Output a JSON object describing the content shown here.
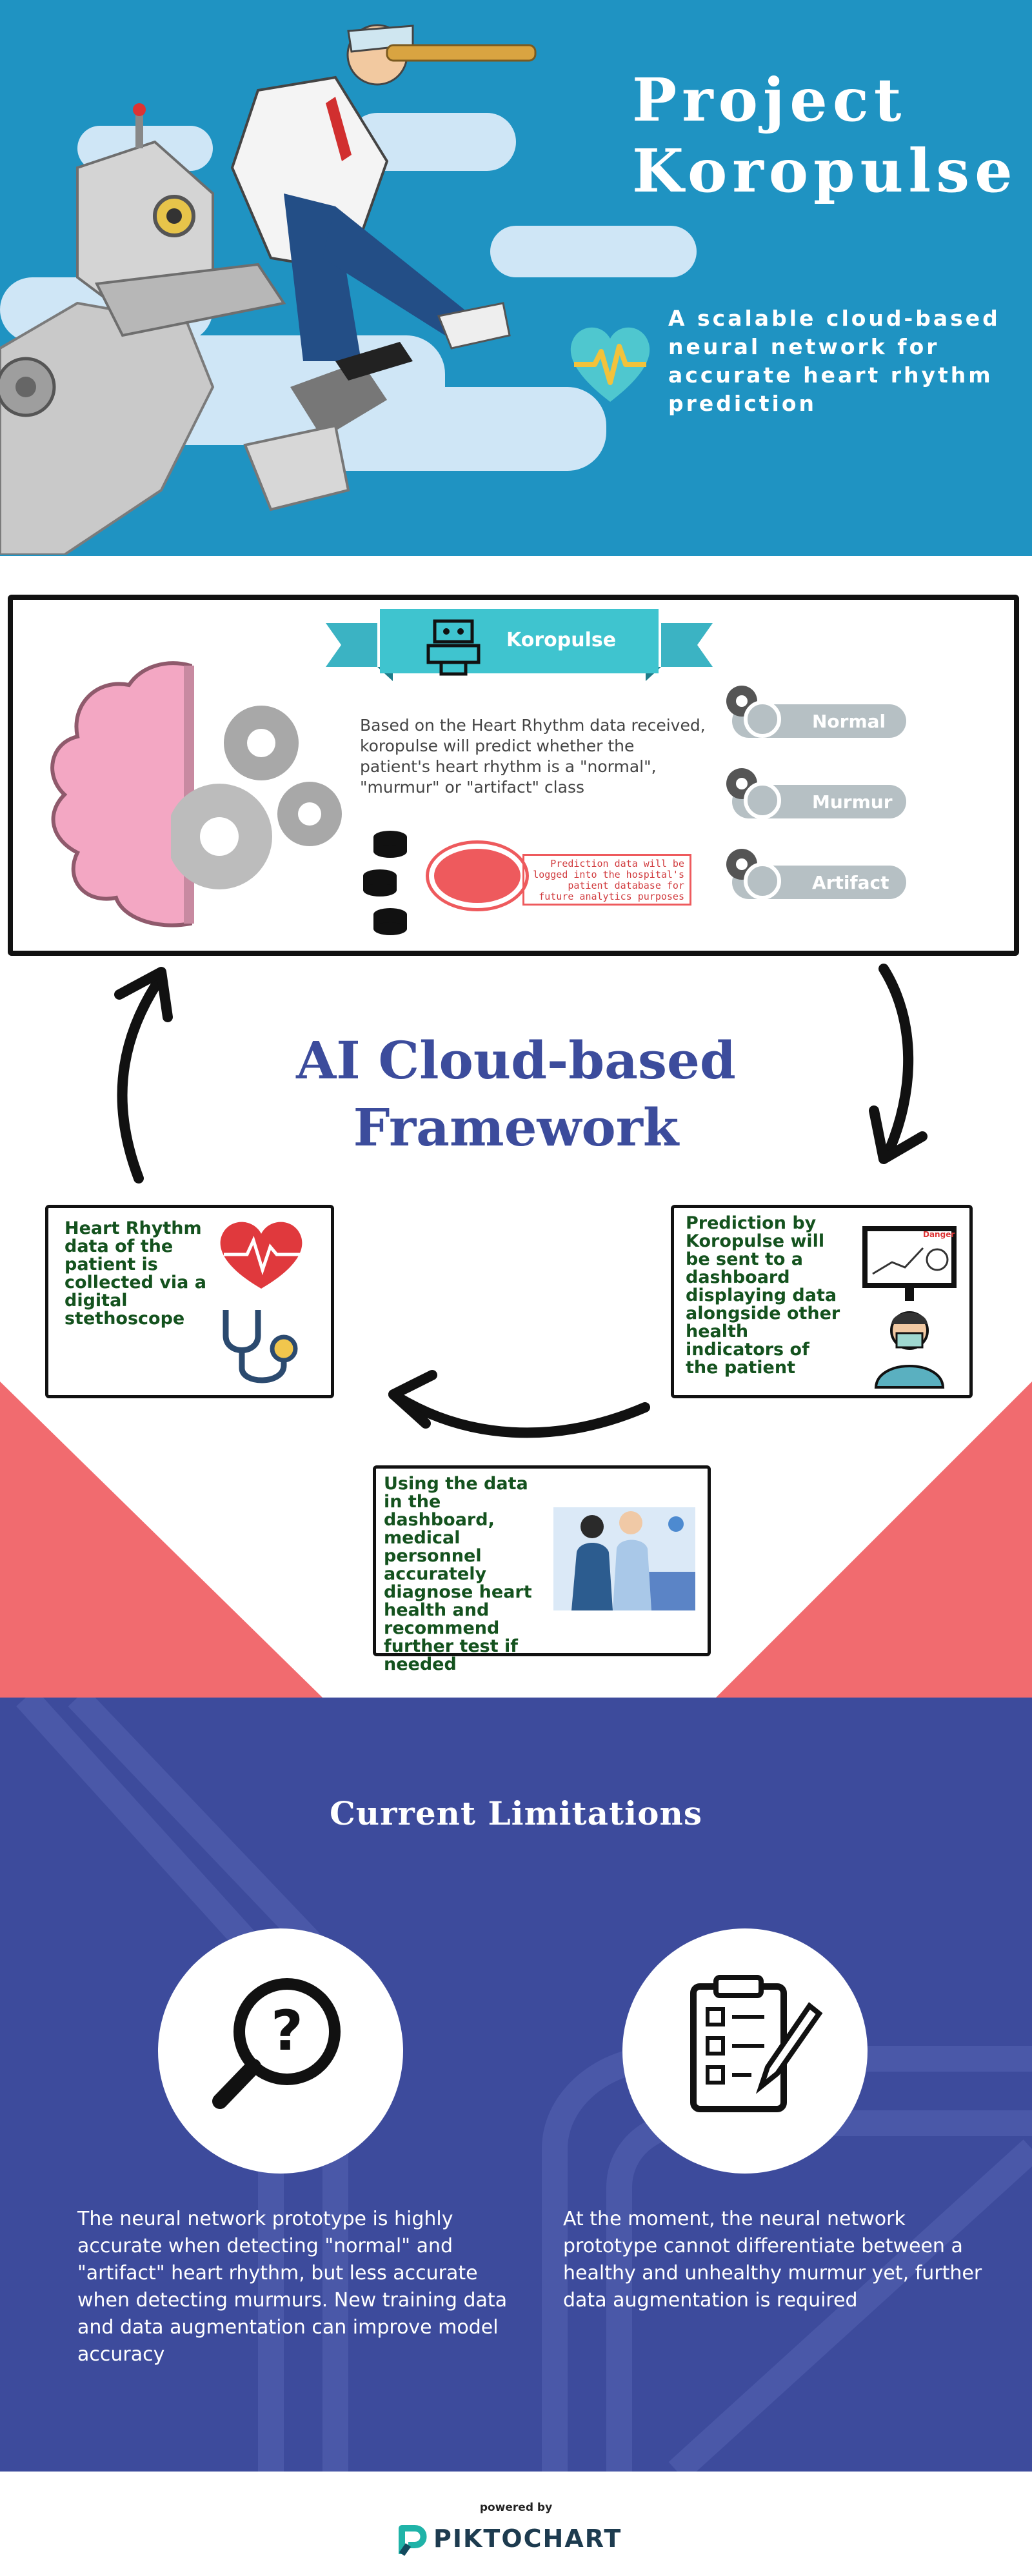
{
  "hero": {
    "title_line1": "Project",
    "title_line2": "Koropulse",
    "subtitle": "A scalable cloud-based neural network for accurate heart rhythm prediction"
  },
  "framework": {
    "banner_label": "Koropulse",
    "description": "Based on the Heart Rhythm data received, koropulse will predict whether the patient's heart rhythm is a \"normal\", \"murmur\" or \"artifact\" class",
    "classes": [
      "Normal",
      "Murmur",
      "Artifact"
    ],
    "log_note": "Prediction data will be logged into the hospital's patient database for future analytics purposes",
    "title_line1": "AI Cloud-based",
    "title_line2": "Framework",
    "step_collect": "Heart Rhythm data of the patient is collected via a digital stethoscope",
    "step_dashboard": "Prediction by Koropulse will be sent to a dashboard displaying data alongside other health indicators of the patient",
    "step_diagnose": "Using the data in the dashboard, medical personnel accurately diagnose heart health and recommend further test if needed",
    "monitor_label": "Danger"
  },
  "limitations": {
    "title": "Current Limitations",
    "left_text": "The neural network prototype is highly accurate when detecting \"normal\" and \"artifact\" heart rhythm, but less accurate when detecting murmurs. New training data and data augmentation can improve model accuracy",
    "right_text": "At the moment, the neural network prototype cannot differentiate between a healthy and unhealthy murmur yet, further data augmentation is required"
  },
  "footer": {
    "powered_by": "powered by",
    "brand": "PIKTOCHART"
  },
  "colors": {
    "hero_blue": "#1f93c2",
    "teal": "#25b4c8",
    "navy": "#3d4b9c",
    "coral": "#f16b6f",
    "dark_green": "#14521e"
  },
  "icons": [
    "telescope-doctor-illustration",
    "robot-illustration",
    "heart-pulse-icon",
    "robot-icon",
    "brain-icon",
    "gear-icon",
    "database-icon",
    "heart-icon",
    "stethoscope-icon",
    "monitor-icon",
    "doctor-icon",
    "magnifier-question-icon",
    "checklist-icon",
    "piktochart-logo"
  ]
}
